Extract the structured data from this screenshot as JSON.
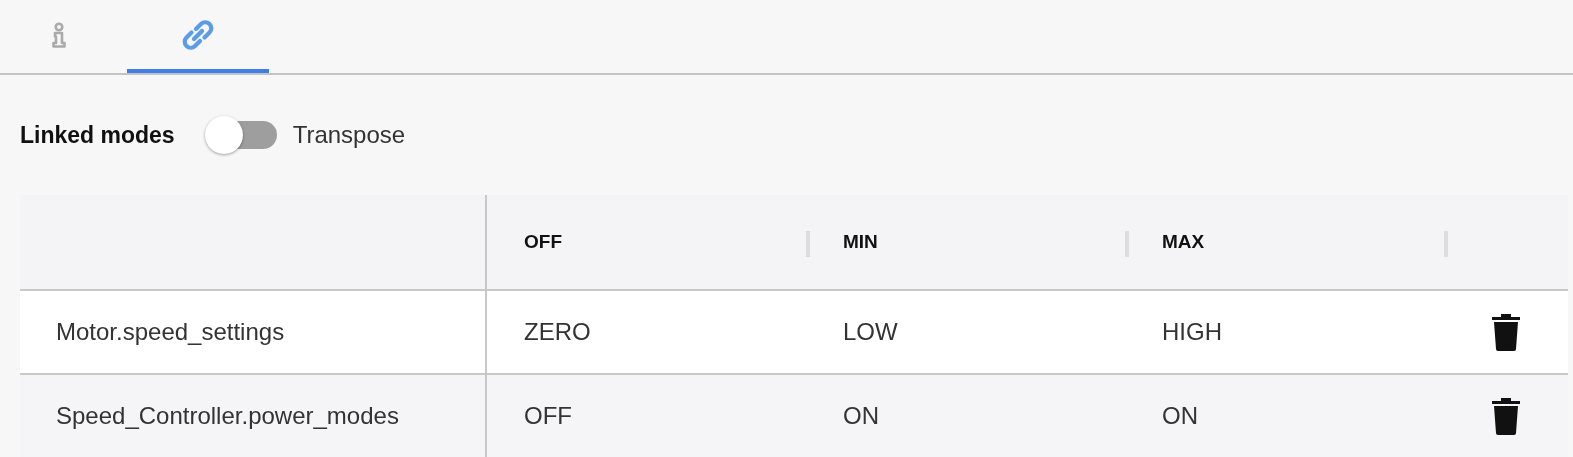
{
  "tabs": [
    {
      "kind": "info",
      "selected": false
    },
    {
      "kind": "link",
      "selected": true
    }
  ],
  "linked_modes": {
    "title": "Linked modes",
    "transpose": {
      "label": "Transpose",
      "on": false
    }
  },
  "table": {
    "columns": [
      "OFF",
      "MIN",
      "MAX"
    ],
    "rows": [
      {
        "name": "Motor.speed_settings",
        "values": [
          "ZERO",
          "LOW",
          "HIGH"
        ]
      },
      {
        "name": "Speed_Controller.power_modes",
        "values": [
          "OFF",
          "ON",
          "ON"
        ]
      }
    ]
  }
}
